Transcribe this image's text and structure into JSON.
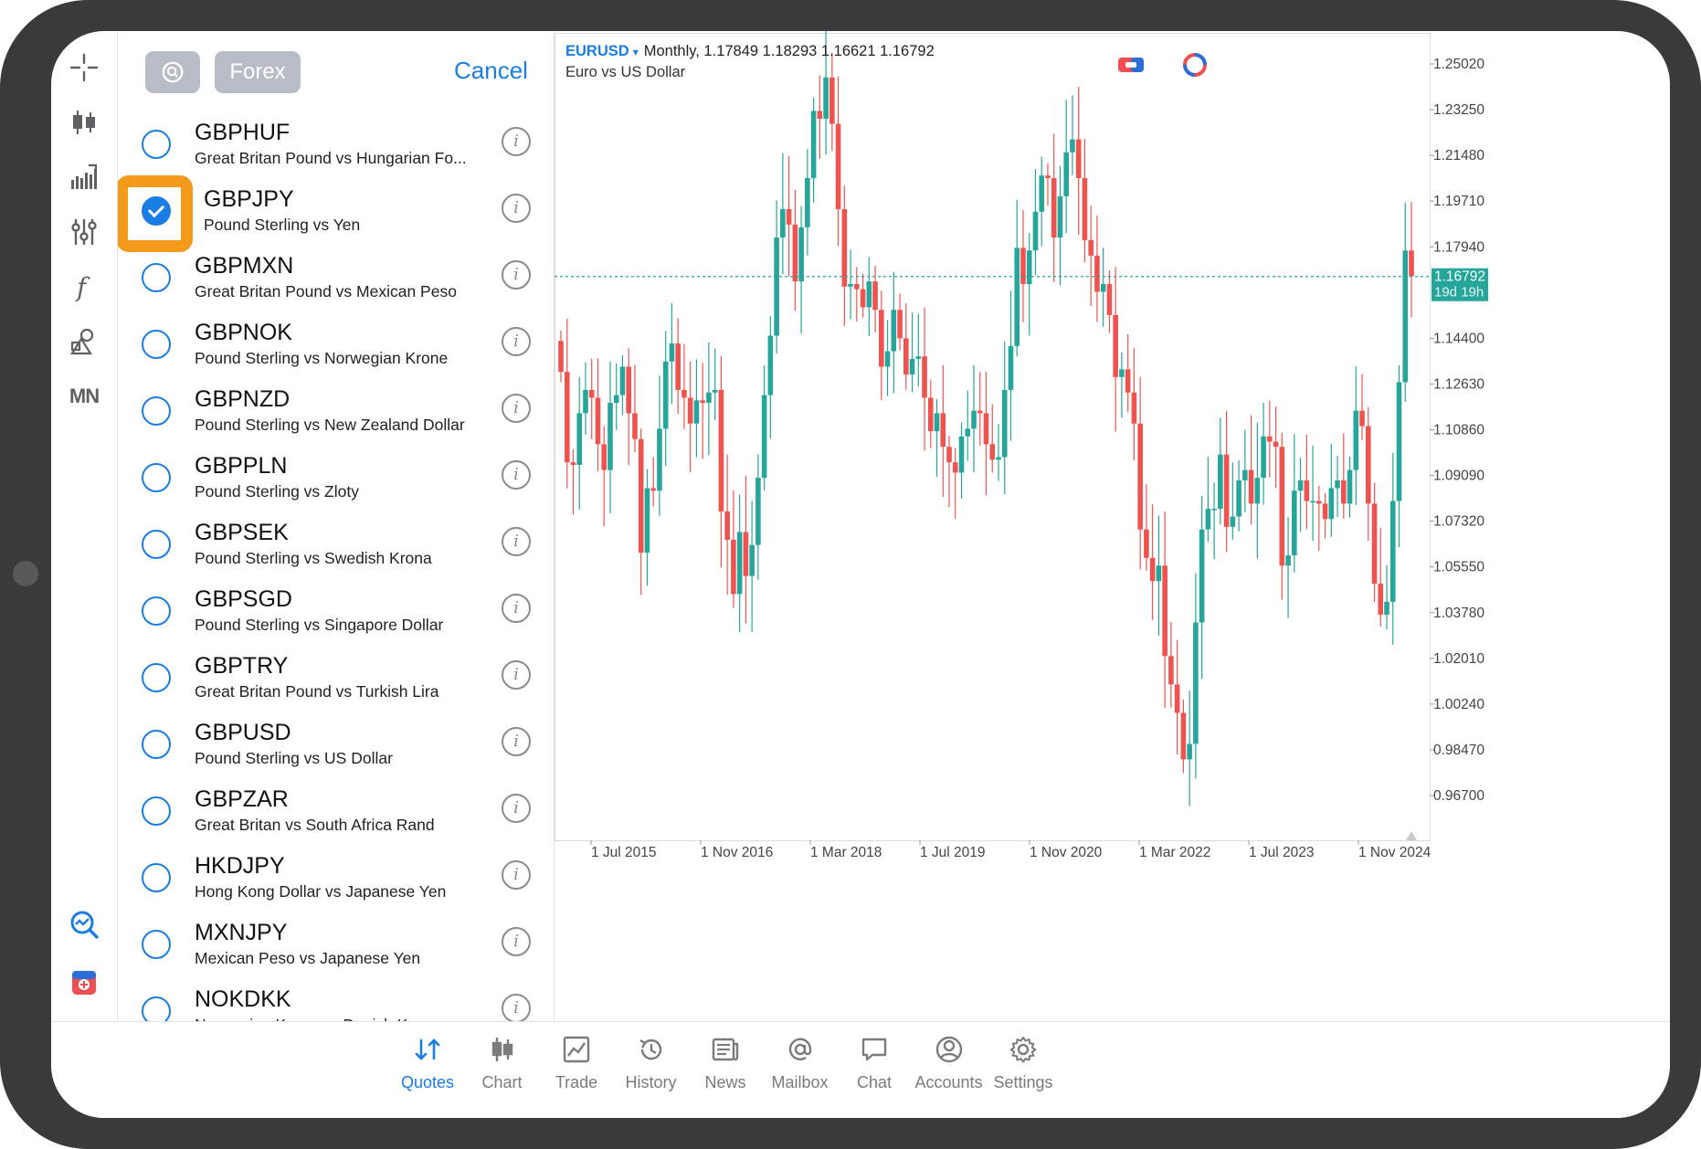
{
  "list": {
    "group_label": "Forex",
    "cancel_label": "Cancel",
    "items": [
      {
        "symbol": "GBPHUF",
        "description": "Great Britan Pound vs Hungarian Fo...",
        "checked": false
      },
      {
        "symbol": "GBPJPY",
        "description": "Pound Sterling vs Yen",
        "checked": true
      },
      {
        "symbol": "GBPMXN",
        "description": "Great Britan Pound vs Mexican Peso",
        "checked": false
      },
      {
        "symbol": "GBPNOK",
        "description": "Pound Sterling vs Norwegian Krone",
        "checked": false
      },
      {
        "symbol": "GBPNZD",
        "description": "Pound Sterling vs New Zealand Dollar",
        "checked": false
      },
      {
        "symbol": "GBPPLN",
        "description": "Pound Sterling vs Zloty",
        "checked": false
      },
      {
        "symbol": "GBPSEK",
        "description": "Pound Sterling vs Swedish Krona",
        "checked": false
      },
      {
        "symbol": "GBPSGD",
        "description": "Pound Sterling vs Singapore Dollar",
        "checked": false
      },
      {
        "symbol": "GBPTRY",
        "description": "Great Britan Pound vs Turkish Lira",
        "checked": false
      },
      {
        "symbol": "GBPUSD",
        "description": "Pound Sterling vs US Dollar",
        "checked": false
      },
      {
        "symbol": "GBPZAR",
        "description": "Great Britan vs South Africa Rand",
        "checked": false
      },
      {
        "symbol": "HKDJPY",
        "description": "Hong Kong Dollar vs Japanese Yen",
        "checked": false
      },
      {
        "symbol": "MXNJPY",
        "description": "Mexican Peso vs Japanese Yen",
        "checked": false
      },
      {
        "symbol": "NOKDKK",
        "description": "Norwegian Krone vs Danish Krone",
        "checked": false
      }
    ]
  },
  "rail": {
    "mn_label": "MN"
  },
  "chart": {
    "symbol": "EURUSD",
    "caret": "▾",
    "ohlc_line": "Monthly, 1.17849 1.18293 1.16621 1.16792",
    "description": "Euro vs US Dollar",
    "current_price": "1.16792",
    "countdown": "19d 19h"
  },
  "chart_data": {
    "type": "candlestick",
    "timeframe": "Monthly",
    "y_ticks": [
      "1.25020",
      "1.23250",
      "1.21480",
      "1.19710",
      "1.17940",
      "1.14400",
      "1.12630",
      "1.10860",
      "1.09090",
      "1.07320",
      "1.05550",
      "1.03780",
      "1.02010",
      "1.00240",
      "0.98470",
      "0.96700"
    ],
    "x_ticks": [
      "1 Jul 2015",
      "1 Nov 2016",
      "1 Mar 2018",
      "1 Jul 2019",
      "1 Nov 2020",
      "1 Mar 2022",
      "1 Jul 2023",
      "1 Nov 2024"
    ],
    "last_price": 1.16792,
    "close_series": [
      1.131,
      1.096,
      1.095,
      1.115,
      1.124,
      1.121,
      1.103,
      1.093,
      1.119,
      1.122,
      1.133,
      1.115,
      1.105,
      1.061,
      1.086,
      1.085,
      1.109,
      1.135,
      1.142,
      1.124,
      1.121,
      1.111,
      1.12,
      1.119,
      1.123,
      1.124,
      1.077,
      1.066,
      1.045,
      1.069,
      1.052,
      1.064,
      1.09,
      1.122,
      1.145,
      1.183,
      1.194,
      1.188,
      1.166,
      1.187,
      1.206,
      1.232,
      1.229,
      1.245,
      1.227,
      1.194,
      1.164,
      1.165,
      1.163,
      1.156,
      1.166,
      1.155,
      1.133,
      1.139,
      1.155,
      1.144,
      1.13,
      1.136,
      1.137,
      1.121,
      1.108,
      1.115,
      1.102,
      1.096,
      1.092,
      1.106,
      1.109,
      1.116,
      1.115,
      1.103,
      1.097,
      1.098,
      1.124,
      1.141,
      1.179,
      1.165,
      1.178,
      1.193,
      1.207,
      1.206,
      1.183,
      1.199,
      1.216,
      1.221,
      1.206,
      1.182,
      1.176,
      1.162,
      1.165,
      1.153,
      1.129,
      1.132,
      1.123,
      1.111,
      1.07,
      1.059,
      1.05,
      1.056,
      1.021,
      1.01,
      0.999,
      0.981,
      0.987,
      1.034,
      1.07,
      1.078,
      1.078,
      1.099,
      1.071,
      1.075,
      1.089,
      1.093,
      1.08,
      1.09,
      1.106,
      1.104,
      1.102,
      1.056,
      1.06,
      1.085,
      1.089,
      1.081,
      1.081,
      1.08,
      1.074,
      1.086,
      1.089,
      1.08,
      1.093,
      1.116,
      1.11,
      1.08,
      1.049,
      1.037,
      1.042,
      1.081,
      1.127,
      1.178,
      1.168
    ]
  },
  "nav": {
    "items": [
      {
        "label": "Quotes",
        "icon": "quotes-icon",
        "active": true
      },
      {
        "label": "Chart",
        "icon": "chart-icon",
        "active": false
      },
      {
        "label": "Trade",
        "icon": "trade-icon",
        "active": false
      },
      {
        "label": "History",
        "icon": "history-icon",
        "active": false
      },
      {
        "label": "News",
        "icon": "news-icon",
        "active": false
      },
      {
        "label": "Mailbox",
        "icon": "mailbox-icon",
        "active": false
      },
      {
        "label": "Chat",
        "icon": "chat-icon",
        "active": false
      },
      {
        "label": "Accounts",
        "icon": "accounts-icon",
        "active": false
      },
      {
        "label": "Settings",
        "icon": "settings-icon",
        "active": false
      }
    ]
  },
  "colors": {
    "accent": "#1a7de3",
    "bull": "#26a69a",
    "bear": "#ef5350",
    "highlight": "#f39a1a"
  }
}
